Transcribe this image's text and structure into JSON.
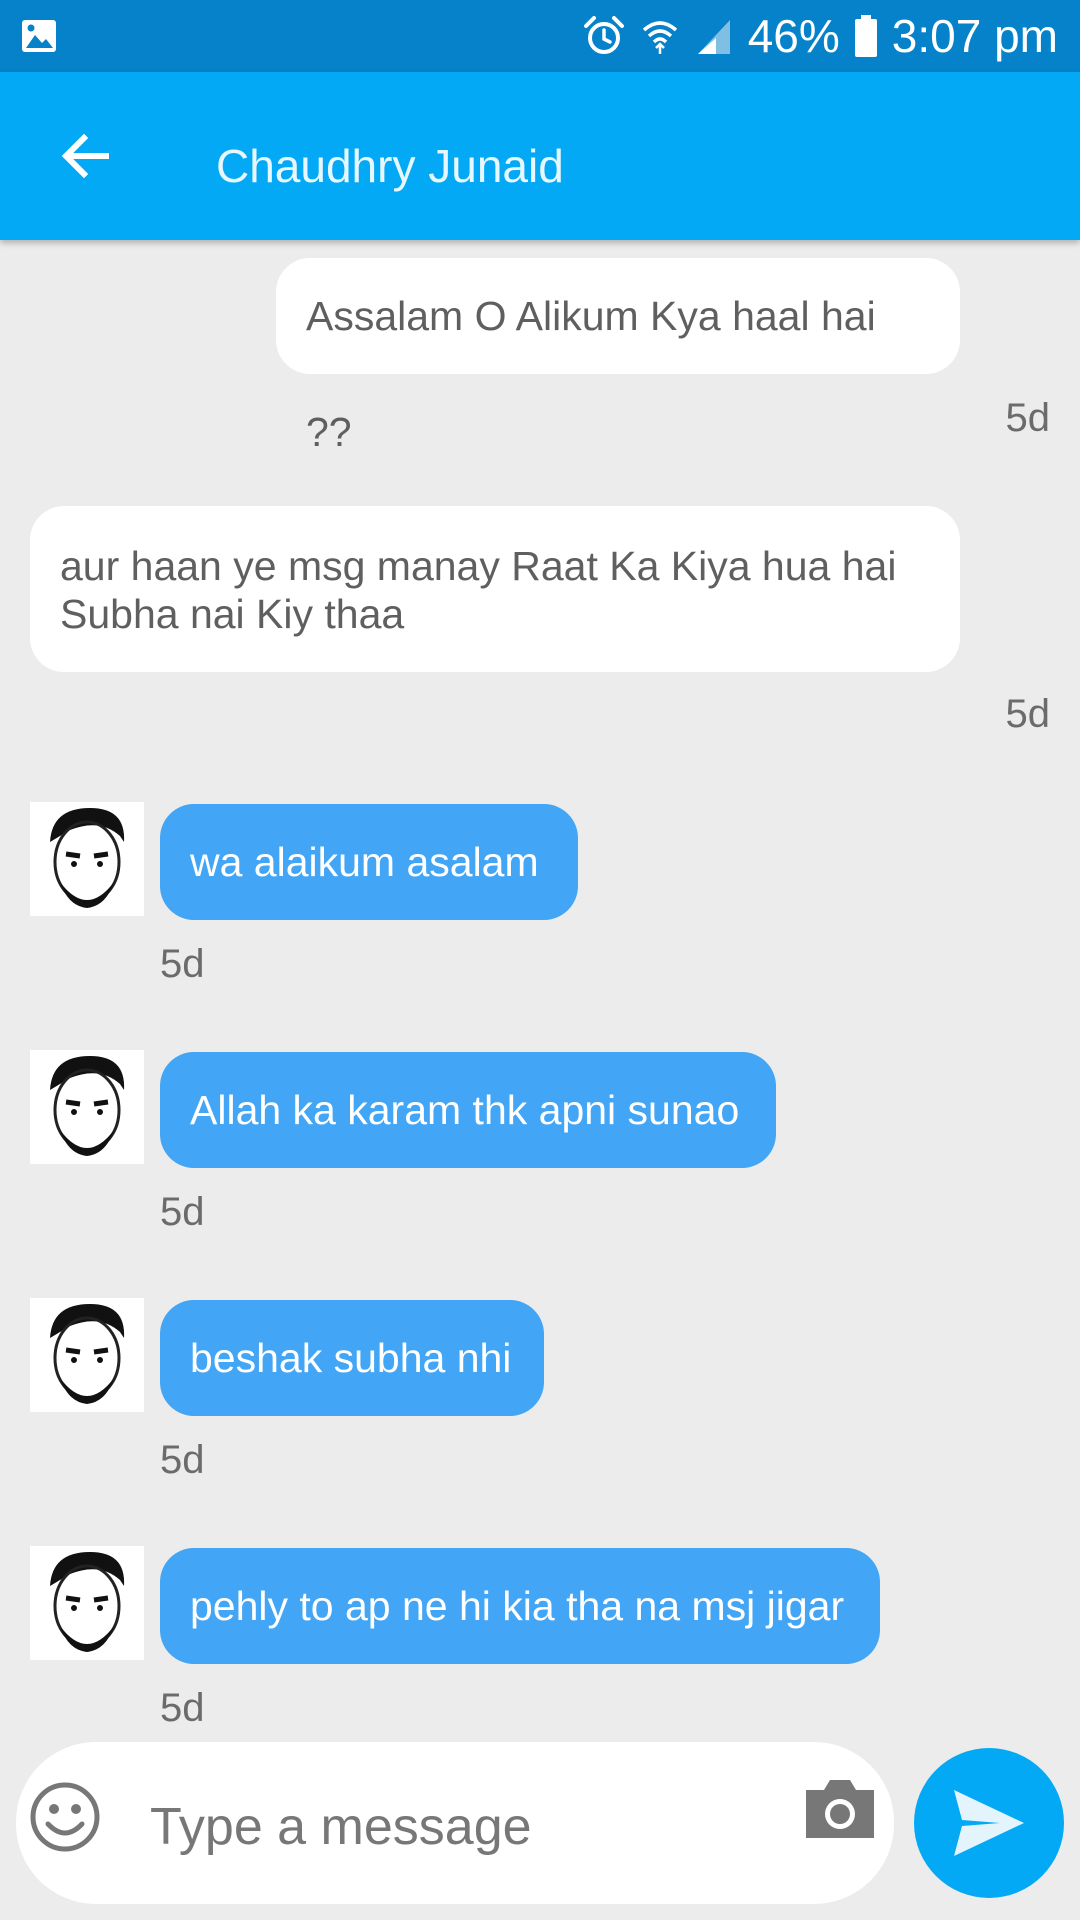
{
  "status_bar": {
    "battery": "46%",
    "time": "3:07 pm",
    "icons": [
      "gallery-icon",
      "alarm-icon",
      "wifi-icon",
      "signal-icon",
      "battery-icon"
    ]
  },
  "app_bar": {
    "title": "Chaudhry Junaid",
    "back_icon": "arrow-left-icon"
  },
  "messages": [
    {
      "direction": "out",
      "text": "Assalam O Alikum Kya haal hai ??",
      "time": "5d"
    },
    {
      "direction": "out",
      "text": "aur haan ye msg manay Raat Ka Kiya hua hai Subha nai Kiy thaa",
      "time": "5d"
    },
    {
      "direction": "in",
      "text": "wa alaikum asalam",
      "time": "5d"
    },
    {
      "direction": "in",
      "text": "Allah ka karam thk apni sunao",
      "time": "5d"
    },
    {
      "direction": "in",
      "text": "beshak subha nhi",
      "time": "5d"
    },
    {
      "direction": "in",
      "text": "pehly to ap ne hi kia tha na msj jigar",
      "time": "5d"
    }
  ],
  "composer": {
    "placeholder": "Type a message",
    "emoji_icon": "emoji-icon",
    "camera_icon": "camera-icon",
    "send_icon": "send-icon"
  },
  "colors": {
    "status_bar": "#0582c9",
    "app_bar": "#03a9f4",
    "incoming_bubble": "#42a5f5",
    "outgoing_bubble": "#ffffff",
    "background": "#ececec"
  }
}
